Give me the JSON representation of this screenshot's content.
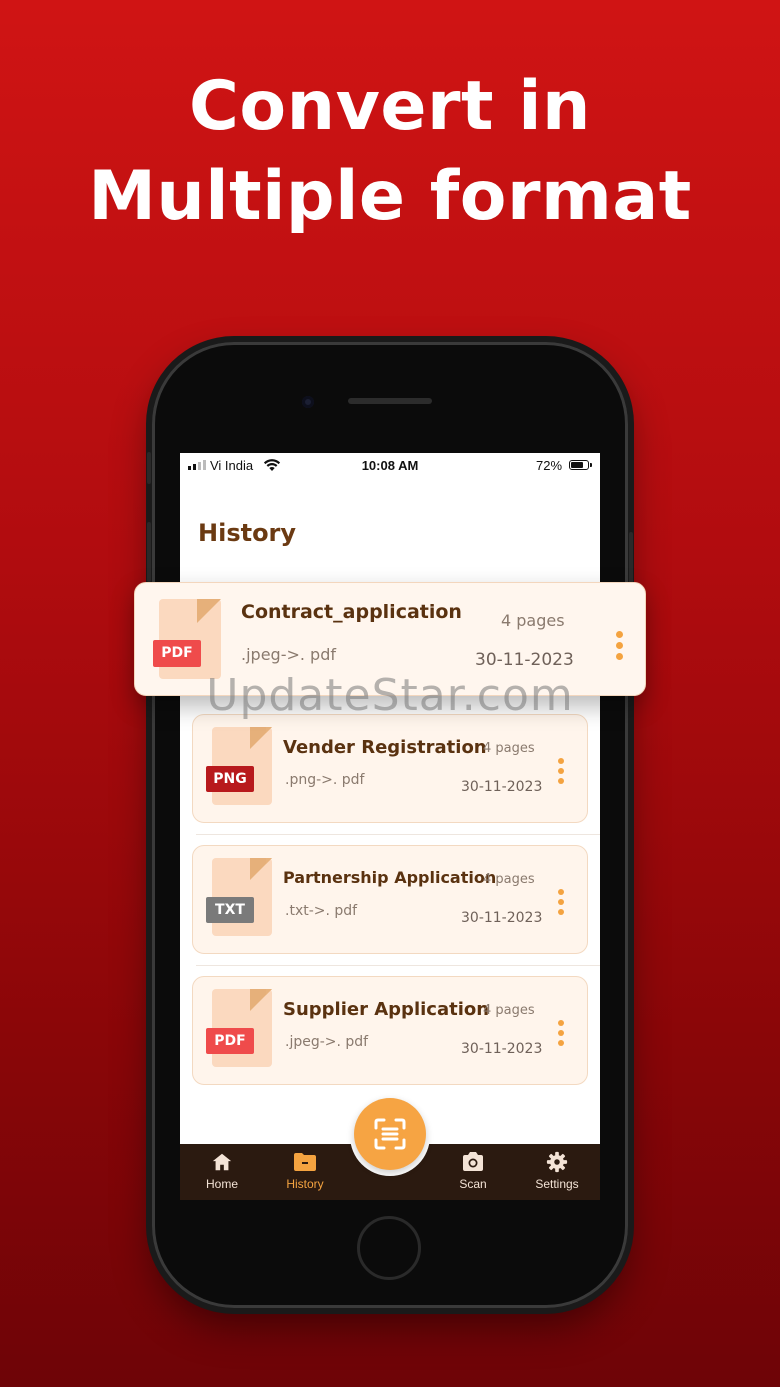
{
  "headline": {
    "line1": "Convert in",
    "line2": "Multiple format"
  },
  "status_bar": {
    "carrier": "Vi India",
    "time": "10:08 AM",
    "battery": "72%"
  },
  "page_title": "History",
  "history_items": [
    {
      "name": "Contract_application",
      "format": "PDF",
      "conversion": ".jpeg->. pdf",
      "pages": "4 pages",
      "date": "30-11-2023",
      "badge_color": "#ef4b4b"
    },
    {
      "name": "Vender Registration",
      "format": "PNG",
      "conversion": ".png->. pdf",
      "pages": "4 pages",
      "date": "30-11-2023",
      "badge_color": "#b8191c"
    },
    {
      "name": "Partnership Application",
      "format": "TXT",
      "conversion": ".txt->. pdf",
      "pages": "4 pages",
      "date": "30-11-2023",
      "badge_color": "#7a7a7a"
    },
    {
      "name": "Supplier Application",
      "format": "PDF",
      "conversion": ".jpeg->. pdf",
      "pages": "4 pages",
      "date": "30-11-2023",
      "badge_color": "#ef4b4b"
    }
  ],
  "nav": {
    "home": "Home",
    "history": "History",
    "scan": "Scan",
    "settings": "Settings"
  },
  "icons": {
    "fab": "scan-frame-icon",
    "home": "house-icon",
    "history": "folder-icon",
    "scan": "camera-icon",
    "settings": "gear-icon"
  },
  "colors": {
    "accent": "#f4a340",
    "title_brown": "#6b3a12",
    "tabbar": "#2b1a10",
    "background_red": "#c51012"
  },
  "watermark": "UpdateStar.com"
}
